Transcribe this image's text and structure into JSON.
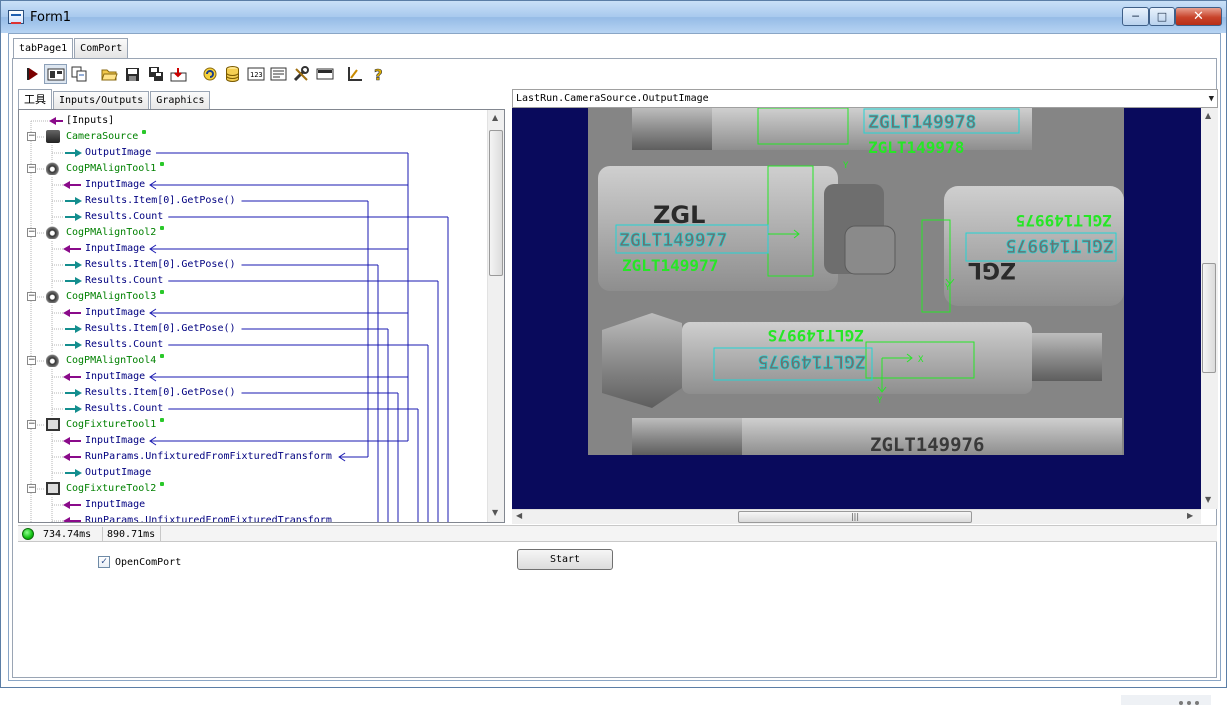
{
  "window": {
    "title": "Form1",
    "min_label": "─",
    "max_label": "□",
    "close_label": "✕"
  },
  "outer_tabs": [
    {
      "label": "tabPage1",
      "active": true
    },
    {
      "label": "ComPort",
      "active": false
    }
  ],
  "toolbar": {
    "icons": [
      "run-once-icon",
      "continuous-run-icon",
      "copy-icon",
      "open-folder-icon",
      "save-icon",
      "save-as-icon",
      "import-icon",
      "refresh-icon",
      "database-icon",
      "number-icon",
      "text-icon",
      "tools-icon",
      "debug-icon",
      "measure-icon",
      "help-icon"
    ]
  },
  "left_tabs": [
    {
      "label": "工具",
      "active": true
    },
    {
      "label": "Inputs/Outputs",
      "active": false
    },
    {
      "label": "Graphics",
      "active": false
    }
  ],
  "tree": {
    "rows": [
      {
        "text": "[Inputs]",
        "kind": "inputs-node",
        "level": 0
      },
      {
        "text": "CameraSource",
        "kind": "tool",
        "level": 0,
        "icon": "camera-icon"
      },
      {
        "text": "OutputImage",
        "kind": "output",
        "level": 1
      },
      {
        "text": "CogPMAlignTool1",
        "kind": "tool",
        "level": 0,
        "icon": "pmalign-icon"
      },
      {
        "text": "InputImage",
        "kind": "input",
        "level": 1
      },
      {
        "text": "Results.Item[0].GetPose()",
        "kind": "output",
        "level": 1
      },
      {
        "text": "Results.Count",
        "kind": "output",
        "level": 1
      },
      {
        "text": "CogPMAlignTool2",
        "kind": "tool",
        "level": 0,
        "icon": "pmalign-icon"
      },
      {
        "text": "InputImage",
        "kind": "input",
        "level": 1
      },
      {
        "text": "Results.Item[0].GetPose()",
        "kind": "output",
        "level": 1
      },
      {
        "text": "Results.Count",
        "kind": "output",
        "level": 1
      },
      {
        "text": "CogPMAlignTool3",
        "kind": "tool",
        "level": 0,
        "icon": "pmalign-icon"
      },
      {
        "text": "InputImage",
        "kind": "input",
        "level": 1
      },
      {
        "text": "Results.Item[0].GetPose()",
        "kind": "output",
        "level": 1
      },
      {
        "text": "Results.Count",
        "kind": "output",
        "level": 1
      },
      {
        "text": "CogPMAlignTool4",
        "kind": "tool",
        "level": 0,
        "icon": "pmalign-icon"
      },
      {
        "text": "InputImage",
        "kind": "input",
        "level": 1
      },
      {
        "text": "Results.Item[0].GetPose()",
        "kind": "output",
        "level": 1
      },
      {
        "text": "Results.Count",
        "kind": "output",
        "level": 1
      },
      {
        "text": "CogFixtureTool1",
        "kind": "tool",
        "level": 0,
        "icon": "fixture-icon"
      },
      {
        "text": "InputImage",
        "kind": "input",
        "level": 1
      },
      {
        "text": "RunParams.UnfixturedFromFixturedTransform",
        "kind": "input",
        "level": 1
      },
      {
        "text": "OutputImage",
        "kind": "output",
        "level": 1
      },
      {
        "text": "CogFixtureTool2",
        "kind": "tool",
        "level": 0,
        "icon": "fixture-icon"
      },
      {
        "text": "InputImage",
        "kind": "input",
        "level": 1
      },
      {
        "text": "RunParams.UnfixturedFromFixturedTransform",
        "kind": "input",
        "level": 1
      }
    ]
  },
  "image_display": {
    "selected_image": "LastRun.CameraSource.OutputImage",
    "text_top": "ZGLT149978",
    "text_left_label": "ZGL",
    "text_left": "ZGLT149977",
    "text_right_label": "ZGL",
    "text_right": "ZGLT149975",
    "text_middle": "ZGLT14997S",
    "text_bottom": "ZGLT149976",
    "axis_x": "X",
    "axis_y": "Y",
    "colors": {
      "background": "#090a5c",
      "region": "#26e626",
      "ocr_box": "#22d4d4"
    }
  },
  "status": {
    "led_color": "#10c010",
    "time1": "734.74ms",
    "time2": "890.71ms"
  },
  "bottom": {
    "checkbox_label": "OpenComPort",
    "checkbox_checked": true,
    "checkbox_mark": "✓",
    "start_label": "Start"
  }
}
